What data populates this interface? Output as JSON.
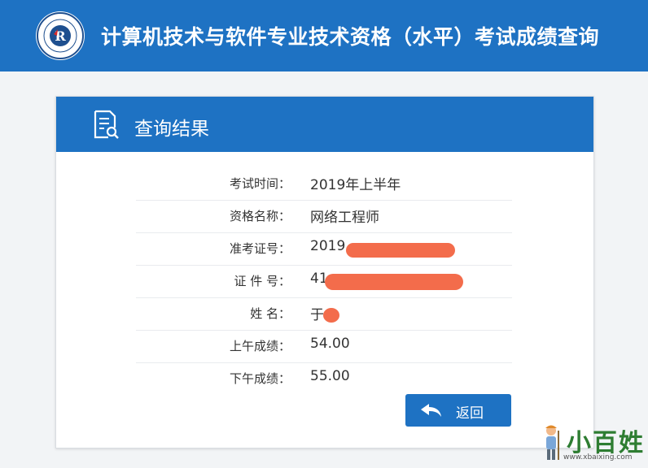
{
  "header": {
    "logo_text": "Computer Qualification Certification",
    "site_title": "计算机技术与软件专业技术资格（水平）考试成绩查询"
  },
  "panel": {
    "title": "查询结果"
  },
  "result_rows": [
    {
      "label": "考试时间：",
      "value": "2019年上半年"
    },
    {
      "label": "资格名称：",
      "value": "网络工程师"
    },
    {
      "label": "准考证号：",
      "value": "2019"
    },
    {
      "label": "证  件  号：",
      "value": "41"
    },
    {
      "label": "姓        名：",
      "value": "于"
    },
    {
      "label": "上午成绩：",
      "value": "54.00"
    },
    {
      "label": "下午成绩：",
      "value": "55.00"
    }
  ],
  "back_button": {
    "label": "返回"
  },
  "watermark": {
    "name": "小百姓",
    "url": "www.xbaixing.com"
  },
  "colors": {
    "brand_blue": "#1e72c3",
    "redaction": "#f36c4b"
  }
}
